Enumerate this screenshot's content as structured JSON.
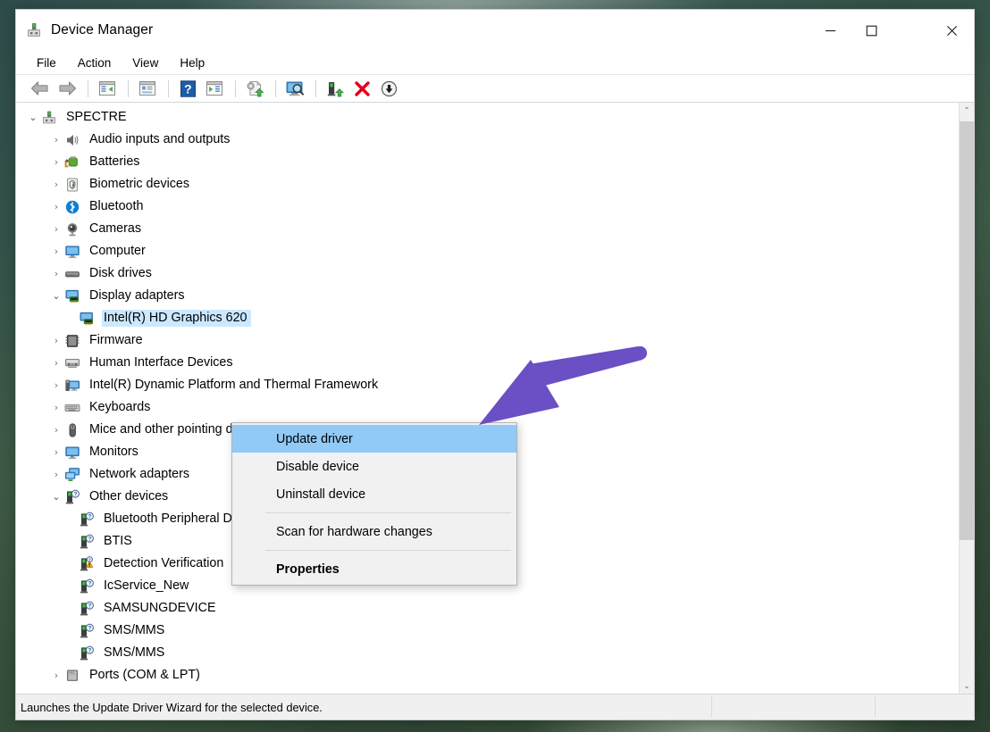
{
  "window": {
    "title": "Device Manager",
    "app_icon": "device-manager-icon",
    "controls": {
      "minimize": "—",
      "maximize": "☐",
      "close": "✕"
    }
  },
  "menubar": {
    "items": [
      {
        "label": "File"
      },
      {
        "label": "Action"
      },
      {
        "label": "View"
      },
      {
        "label": "Help"
      }
    ]
  },
  "toolbar": {
    "buttons": [
      {
        "name": "back-button",
        "icon": "back-arrow-icon"
      },
      {
        "name": "forward-button",
        "icon": "forward-arrow-icon"
      },
      {
        "name": "show-hide-console-tree-button",
        "icon": "console-tree-icon"
      },
      {
        "name": "properties-button",
        "icon": "properties-window-icon"
      },
      {
        "name": "help-button",
        "icon": "question-mark-icon"
      },
      {
        "name": "show-hide-action-pane-button",
        "icon": "action-pane-icon"
      },
      {
        "name": "update-driver-button",
        "icon": "update-driver-icon"
      },
      {
        "name": "scan-for-hardware-changes-button",
        "icon": "scan-hardware-icon"
      },
      {
        "name": "enable-device-button",
        "icon": "enable-device-icon"
      },
      {
        "name": "uninstall-device-button",
        "icon": "red-x-icon"
      },
      {
        "name": "disable-device-button",
        "icon": "down-arrow-circle-icon"
      }
    ]
  },
  "tree": {
    "nodes": [
      {
        "label": "SPECTRE",
        "depth": 0,
        "state": "expanded",
        "icon": "computer-root-icon"
      },
      {
        "label": "Audio inputs and outputs",
        "depth": 1,
        "state": "collapsed",
        "icon": "speaker-icon"
      },
      {
        "label": "Batteries",
        "depth": 1,
        "state": "collapsed",
        "icon": "battery-icon"
      },
      {
        "label": "Biometric devices",
        "depth": 1,
        "state": "collapsed",
        "icon": "fingerprint-icon"
      },
      {
        "label": "Bluetooth",
        "depth": 1,
        "state": "collapsed",
        "icon": "bluetooth-icon"
      },
      {
        "label": "Cameras",
        "depth": 1,
        "state": "collapsed",
        "icon": "camera-icon"
      },
      {
        "label": "Computer",
        "depth": 1,
        "state": "collapsed",
        "icon": "monitor-icon"
      },
      {
        "label": "Disk drives",
        "depth": 1,
        "state": "collapsed",
        "icon": "disk-drive-icon"
      },
      {
        "label": "Display adapters",
        "depth": 1,
        "state": "expanded",
        "icon": "display-adapter-icon"
      },
      {
        "label": "Intel(R) HD Graphics 620",
        "depth": 2,
        "state": "leaf",
        "icon": "display-adapter-icon",
        "selected": true
      },
      {
        "label": "Firmware",
        "depth": 1,
        "state": "collapsed",
        "icon": "firmware-chip-icon"
      },
      {
        "label": "Human Interface Devices",
        "depth": 1,
        "state": "collapsed",
        "icon": "hid-icon"
      },
      {
        "label": "Intel(R) Dynamic Platform and Thermal Framework",
        "depth": 1,
        "state": "collapsed",
        "icon": "system-device-icon"
      },
      {
        "label": "Keyboards",
        "depth": 1,
        "state": "collapsed",
        "icon": "keyboard-icon"
      },
      {
        "label": "Mice and other pointing devices",
        "depth": 1,
        "state": "collapsed",
        "icon": "mouse-icon"
      },
      {
        "label": "Monitors",
        "depth": 1,
        "state": "collapsed",
        "icon": "monitor-icon"
      },
      {
        "label": "Network adapters",
        "depth": 1,
        "state": "collapsed",
        "icon": "network-adapter-icon"
      },
      {
        "label": "Other devices",
        "depth": 1,
        "state": "expanded",
        "icon": "unknown-device-icon"
      },
      {
        "label": "Bluetooth Peripheral Device",
        "depth": 2,
        "state": "leaf",
        "icon": "unknown-device-icon"
      },
      {
        "label": "BTIS",
        "depth": 2,
        "state": "leaf",
        "icon": "unknown-device-icon"
      },
      {
        "label": "Detection Verification",
        "depth": 2,
        "state": "leaf",
        "icon": "warning-device-icon"
      },
      {
        "label": "IcService_New",
        "depth": 2,
        "state": "leaf",
        "icon": "unknown-device-icon"
      },
      {
        "label": "SAMSUNGDEVICE",
        "depth": 2,
        "state": "leaf",
        "icon": "unknown-device-icon"
      },
      {
        "label": "SMS/MMS",
        "depth": 2,
        "state": "leaf",
        "icon": "unknown-device-icon"
      },
      {
        "label": "SMS/MMS",
        "depth": 2,
        "state": "leaf",
        "icon": "unknown-device-icon"
      },
      {
        "label": "Ports (COM & LPT)",
        "depth": 1,
        "state": "collapsed",
        "icon": "port-icon"
      }
    ],
    "twisty_collapsed": "›",
    "twisty_expanded": "⌄"
  },
  "context_menu": {
    "items": [
      {
        "label": "Update driver",
        "highlighted": true,
        "bold": false
      },
      {
        "label": "Disable device",
        "highlighted": false,
        "bold": false
      },
      {
        "label": "Uninstall device",
        "highlighted": false,
        "bold": false
      },
      {
        "separator": true
      },
      {
        "label": "Scan for hardware changes",
        "highlighted": false,
        "bold": false
      },
      {
        "separator": true
      },
      {
        "label": "Properties",
        "highlighted": false,
        "bold": true
      }
    ]
  },
  "statusbar": {
    "text": "Launches the Update Driver Wizard for the selected device."
  },
  "annotation": {
    "arrow_color": "#6b4fc4",
    "name": "purple-pointer-arrow",
    "points_to": "Update driver"
  },
  "scrollbar": {
    "up_arrow": "⌃",
    "down_arrow": "⌄"
  },
  "colors": {
    "selection_blue": "#cce8ff",
    "menu_highlight": "#91c9f7",
    "window_bg": "#ffffff",
    "statusbar_bg": "#f0f0f0",
    "accent_purple": "#6b4fc4"
  }
}
